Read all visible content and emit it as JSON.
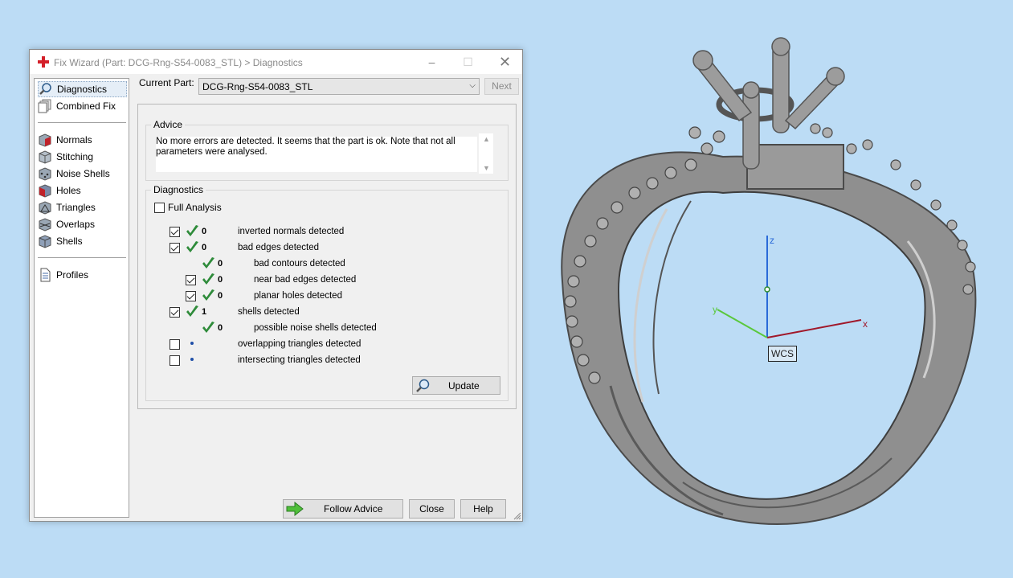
{
  "window": {
    "title": "Fix Wizard (Part: DCG-Rng-S54-0083_STL) > Diagnostics",
    "minimize": "–",
    "maximize": "☐",
    "close": "✕"
  },
  "sidebar": {
    "items": [
      {
        "label": "Diagnostics",
        "icon": "magnifier-icon",
        "active": true
      },
      {
        "label": "Combined Fix",
        "icon": "pages-icon"
      },
      {
        "label": "Normals",
        "icon": "cube-red-icon"
      },
      {
        "label": "Stitching",
        "icon": "cube-stitch-icon"
      },
      {
        "label": "Noise Shells",
        "icon": "cube-dots-icon"
      },
      {
        "label": "Holes",
        "icon": "cube-hole-icon"
      },
      {
        "label": "Triangles",
        "icon": "cube-triangle-icon"
      },
      {
        "label": "Overlaps",
        "icon": "cube-overlap-icon"
      },
      {
        "label": "Shells",
        "icon": "cube-shell-icon"
      },
      {
        "label": "Profiles",
        "icon": "document-icon"
      }
    ]
  },
  "current_part": {
    "label": "Current Part:",
    "value": "DCG-Rng-S54-0083_STL",
    "next_button": "Next"
  },
  "advice": {
    "title": "Advice",
    "text": "No more errors are detected. It seems that the part is ok. Note that not all parameters were analysed."
  },
  "diagnostics": {
    "title": "Diagnostics",
    "full_analysis_label": "Full Analysis",
    "rows": [
      {
        "checkbox": true,
        "checked": true,
        "status": "ok",
        "count": "0",
        "label": "inverted normals detected",
        "indent": 0
      },
      {
        "checkbox": true,
        "checked": true,
        "status": "ok",
        "count": "0",
        "label": "bad edges detected",
        "indent": 0
      },
      {
        "checkbox": false,
        "checked": false,
        "status": "ok",
        "count": "0",
        "label": "bad contours detected",
        "indent": 1
      },
      {
        "checkbox": true,
        "checked": true,
        "status": "ok",
        "count": "0",
        "label": "near bad edges detected",
        "indent": 1
      },
      {
        "checkbox": true,
        "checked": true,
        "status": "ok",
        "count": "0",
        "label": "planar holes detected",
        "indent": 1
      },
      {
        "checkbox": true,
        "checked": true,
        "status": "ok",
        "count": "1",
        "label": "shells detected",
        "indent": 0
      },
      {
        "checkbox": false,
        "checked": false,
        "status": "ok",
        "count": "0",
        "label": "possible noise shells detected",
        "indent": 1
      },
      {
        "checkbox": true,
        "checked": false,
        "status": "pending",
        "count": "",
        "label": "overlapping triangles detected",
        "indent": 0
      },
      {
        "checkbox": true,
        "checked": false,
        "status": "pending",
        "count": "",
        "label": "intersecting triangles detected",
        "indent": 0
      }
    ],
    "update_button": "Update"
  },
  "buttons": {
    "follow_advice": "Follow Advice",
    "close": "Close",
    "help": "Help"
  },
  "viewport": {
    "axis_z": "z",
    "axis_y": "y",
    "axis_x": "x",
    "wcs": "WCS"
  },
  "colors": {
    "background": "#bcdcf5",
    "check_green": "#2e8b3a",
    "axis_x": "#a0182a",
    "axis_y": "#5ac83c",
    "axis_z": "#2a6ad8"
  }
}
